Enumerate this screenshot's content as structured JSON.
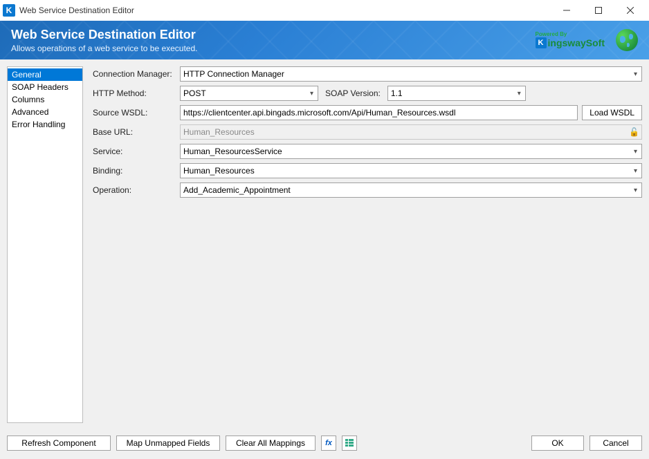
{
  "titlebar": {
    "icon_letter": "K",
    "title": "Web Service Destination Editor"
  },
  "banner": {
    "title": "Web Service Destination Editor",
    "subtitle": "Allows operations of a web service to be executed.",
    "logo_powered": "Powered By",
    "logo_name": "ingswaySoft",
    "logo_k": "K"
  },
  "sidebar": {
    "items": [
      {
        "label": "General",
        "selected": true
      },
      {
        "label": "SOAP Headers",
        "selected": false
      },
      {
        "label": "Columns",
        "selected": false
      },
      {
        "label": "Advanced",
        "selected": false
      },
      {
        "label": "Error Handling",
        "selected": false
      }
    ]
  },
  "form": {
    "connection_manager": {
      "label": "Connection Manager:",
      "value": "HTTP Connection Manager"
    },
    "http_method": {
      "label": "HTTP Method:",
      "value": "POST"
    },
    "soap_version": {
      "label": "SOAP Version:",
      "value": "1.1"
    },
    "source_wsdl": {
      "label": "Source WSDL:",
      "value": "https://clientcenter.api.bingads.microsoft.com/Api/Human_Resources.wsdl"
    },
    "load_wsdl_btn": "Load WSDL",
    "base_url": {
      "label": "Base URL:",
      "value": "Human_Resources"
    },
    "service": {
      "label": "Service:",
      "value": "Human_ResourcesService"
    },
    "binding": {
      "label": "Binding:",
      "value": "Human_Resources"
    },
    "operation": {
      "label": "Operation:",
      "value": "Add_Academic_Appointment"
    }
  },
  "footer": {
    "refresh": "Refresh Component",
    "mapunmapped": "Map Unmapped Fields",
    "clearall": "Clear All Mappings",
    "fx": "fx",
    "ok": "OK",
    "cancel": "Cancel"
  }
}
